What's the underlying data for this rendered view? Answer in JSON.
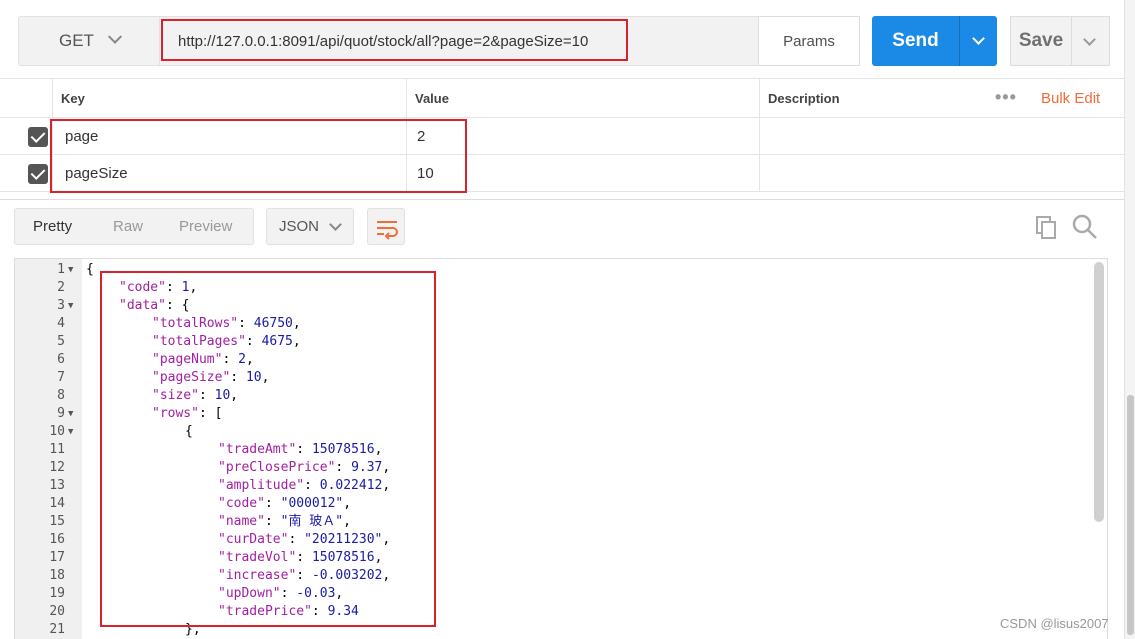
{
  "request": {
    "method": "GET",
    "url": "http://127.0.0.1:8091/api/quot/stock/all?page=2&pageSize=10",
    "params_label": "Params",
    "send_label": "Send",
    "save_label": "Save"
  },
  "params_table": {
    "headers": {
      "key": "Key",
      "value": "Value",
      "description": "Description"
    },
    "bulk_edit": "Bulk Edit",
    "rows": [
      {
        "key": "page",
        "value": "2",
        "checked": true
      },
      {
        "key": "pageSize",
        "value": "10",
        "checked": true
      }
    ]
  },
  "response": {
    "tabs": [
      "Pretty",
      "Raw",
      "Preview"
    ],
    "active_tab": "Pretty",
    "format": "JSON",
    "lines": [
      {
        "n": "1",
        "text": "{"
      },
      {
        "n": "2",
        "text": "\"code\": 1,"
      },
      {
        "n": "3",
        "text": "\"data\": {"
      },
      {
        "n": "4",
        "text": "\"totalRows\": 46750,"
      },
      {
        "n": "5",
        "text": "\"totalPages\": 4675,"
      },
      {
        "n": "6",
        "text": "\"pageNum\": 2,"
      },
      {
        "n": "7",
        "text": "\"pageSize\": 10,"
      },
      {
        "n": "8",
        "text": "\"size\": 10,"
      },
      {
        "n": "9",
        "text": "\"rows\": ["
      },
      {
        "n": "10",
        "text": "{"
      },
      {
        "n": "11",
        "text": "\"tradeAmt\": 15078516,"
      },
      {
        "n": "12",
        "text": "\"preClosePrice\": 9.37,"
      },
      {
        "n": "13",
        "text": "\"amplitude\": 0.022412,"
      },
      {
        "n": "14",
        "text": "\"code\": \"000012\","
      },
      {
        "n": "15",
        "text": "\"name\": \"南 玻Ａ\","
      },
      {
        "n": "16",
        "text": "\"curDate\": \"20211230\","
      },
      {
        "n": "17",
        "text": "\"tradeVol\": 15078516,"
      },
      {
        "n": "18",
        "text": "\"increase\": -0.003202,"
      },
      {
        "n": "19",
        "text": "\"upDown\": -0.03,"
      },
      {
        "n": "20",
        "text": "\"tradePrice\": 9.34"
      },
      {
        "n": "21",
        "text": "},"
      }
    ]
  },
  "watermark": "CSDN @lisus2007"
}
